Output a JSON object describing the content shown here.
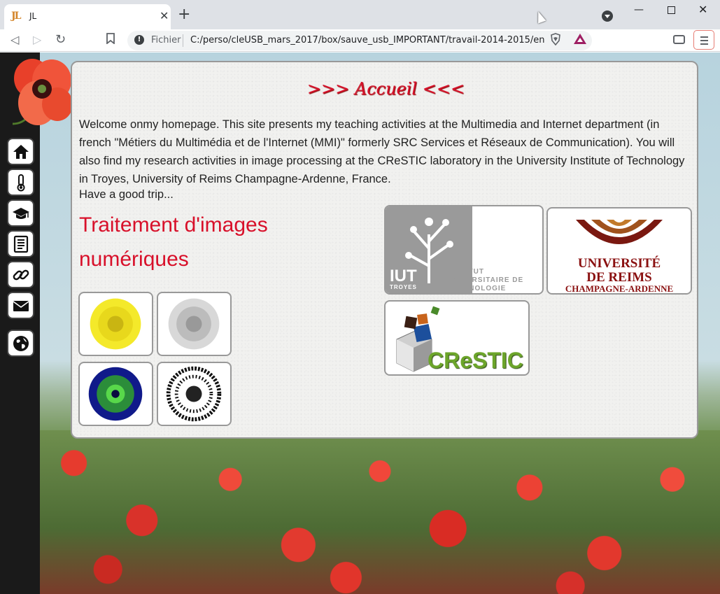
{
  "browser": {
    "tab_favicon": "JL",
    "tab_title": "JL",
    "tab_close": "✕",
    "new_tab": "+",
    "url_scheme": "Fichier",
    "url": "C:/perso/cleUSB_mars_2017/box/sauve_usb_IMPORTANT/travail-2014-2015/en...",
    "window_controls": {
      "minimize": "—",
      "close": "✕"
    }
  },
  "sidebar": {
    "items": [
      {
        "name": "home-icon"
      },
      {
        "name": "thermometer-icon"
      },
      {
        "name": "graduation-cap-icon"
      },
      {
        "name": "document-icon"
      },
      {
        "name": "link-icon"
      },
      {
        "name": "mail-icon"
      },
      {
        "name": "globe-icon"
      }
    ]
  },
  "content": {
    "heading": ">>> Accueil <<<",
    "intro": "Welcome onmy homepage. This site presents my teaching activities at the Multimedia and Internet department (in french \"Métiers du Multimédia et de l'Internet (MMI)\" formerly SRC Services et Réseaux de Communication). You will also find my research activities in image processing at the CReSTIC laboratory in the University Institute of Technology in Troyes, University of Reims Champagne-Ardenne, France.",
    "trip": "Have a good trip...",
    "subtitle": "Traitement d'images numériques"
  },
  "logos": {
    "iut": {
      "abbr": "IUT",
      "city": "TROYES",
      "line1": "INSTITUT",
      "line2": "UNIVERSITAIRE DE",
      "line3": "TECHNOLOGIE"
    },
    "reims": {
      "line1": "UNIVERSITÉ",
      "line2": "DE REIMS",
      "line3": "CHAMPAGNE-ARDENNE"
    },
    "crestic": {
      "label": "CReSTIC"
    }
  },
  "colors": {
    "accent": "#d8102a",
    "sidebar": "#1a1a1a"
  }
}
